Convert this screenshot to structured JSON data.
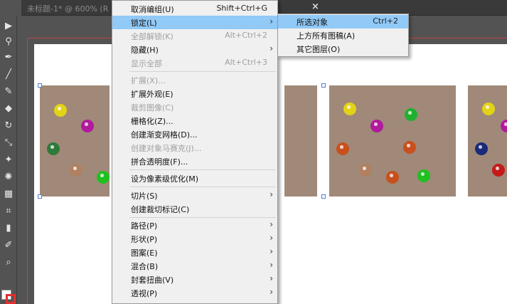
{
  "tab": {
    "title": "未标题-1* @ 600% (R",
    "close": "×"
  },
  "toolbar": {
    "icons": [
      "selection-arrow-icon",
      "lasso-icon",
      "pen-icon",
      "line-icon",
      "paintbrush-icon",
      "eraser-icon",
      "rotate-icon",
      "scale-icon",
      "puppet-warp-icon",
      "symbol-sprayer-icon",
      "gradient-icon",
      "mesh-icon",
      "column-graph-icon",
      "eyedropper-icon",
      "zoom-icon"
    ],
    "glyphs": [
      "▶",
      "⚲",
      "✒",
      "╱",
      "✎",
      "◆",
      "↻",
      "⤡",
      "✦",
      "✺",
      "▦",
      "⌗",
      "▮",
      "✐",
      "⌕"
    ]
  },
  "context_menu": {
    "items": [
      {
        "label": "取消编组(U)",
        "shortcut": "Shift+Ctrl+G",
        "disabled": false,
        "submenu": false
      },
      {
        "label": "锁定(L)",
        "shortcut": "",
        "disabled": false,
        "submenu": true,
        "highlighted": true
      },
      {
        "label": "全部解锁(K)",
        "shortcut": "Alt+Ctrl+2",
        "disabled": true,
        "submenu": false
      },
      {
        "label": "隐藏(H)",
        "shortcut": "",
        "disabled": false,
        "submenu": true
      },
      {
        "label": "显示全部",
        "shortcut": "Alt+Ctrl+3",
        "disabled": true,
        "submenu": false
      },
      {
        "label": "扩展(X)...",
        "shortcut": "",
        "disabled": true,
        "submenu": false
      },
      {
        "label": "扩展外观(E)",
        "shortcut": "",
        "disabled": false,
        "submenu": false
      },
      {
        "label": "裁剪图像(C)",
        "shortcut": "",
        "disabled": true,
        "submenu": false
      },
      {
        "label": "栅格化(Z)...",
        "shortcut": "",
        "disabled": false,
        "submenu": false
      },
      {
        "label": "创建渐变网格(D)...",
        "shortcut": "",
        "disabled": false,
        "submenu": false
      },
      {
        "label": "创建对象马赛克(J)...",
        "shortcut": "",
        "disabled": true,
        "submenu": false
      },
      {
        "label": "拼合透明度(F)...",
        "shortcut": "",
        "disabled": false,
        "submenu": false
      },
      {
        "label": "设为像素级优化(M)",
        "shortcut": "",
        "disabled": false,
        "submenu": false
      },
      {
        "label": "切片(S)",
        "shortcut": "",
        "disabled": false,
        "submenu": true
      },
      {
        "label": "创建裁切标记(C)",
        "shortcut": "",
        "disabled": false,
        "submenu": false
      },
      {
        "label": "路径(P)",
        "shortcut": "",
        "disabled": false,
        "submenu": true
      },
      {
        "label": "形状(P)",
        "shortcut": "",
        "disabled": false,
        "submenu": true
      },
      {
        "label": "图案(E)",
        "shortcut": "",
        "disabled": false,
        "submenu": true
      },
      {
        "label": "混合(B)",
        "shortcut": "",
        "disabled": false,
        "submenu": true
      },
      {
        "label": "封套扭曲(V)",
        "shortcut": "",
        "disabled": false,
        "submenu": true
      },
      {
        "label": "透视(P)",
        "shortcut": "",
        "disabled": false,
        "submenu": true
      }
    ],
    "submenu_arrow": "›"
  },
  "lock_submenu": {
    "items": [
      {
        "label": "所选对象",
        "shortcut": "Ctrl+2",
        "highlighted": true
      },
      {
        "label": "上方所有图稿(A)",
        "shortcut": ""
      },
      {
        "label": "其它图层(O)",
        "shortcut": ""
      }
    ]
  },
  "colors": {
    "panel": "#a08978",
    "highlight": "#91c9f7",
    "artboard_guide": "#bb4444"
  }
}
